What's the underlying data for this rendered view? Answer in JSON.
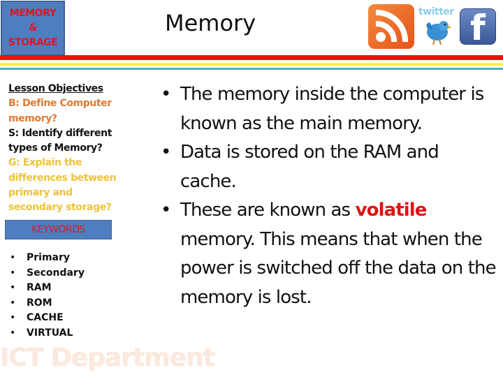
{
  "header": {
    "title_box_lines": [
      "MEMORY",
      "&",
      "STORAGE"
    ],
    "page_title": "Memory",
    "icons": {
      "rss": "rss-feed-icon",
      "twitter_word": "twitter",
      "facebook_letter": "f"
    },
    "stripe_colors": [
      "#ee1010",
      "#f9f542",
      "#4fb0bc"
    ]
  },
  "sidebar": {
    "objectives": {
      "heading": "Lesson Objectives",
      "b": "B: Define Computer memory?",
      "s": "S: Identify different types of Memory?",
      "g": "G: Explain the differences between primary and secondary storage?"
    },
    "keywords_label": "KEYWORDS",
    "keywords": [
      "Primary",
      "Secondary",
      "RAM",
      "ROM",
      "CACHE",
      "VIRTUAL"
    ],
    "department": "ICT Department"
  },
  "main": {
    "bullets": [
      {
        "text": "The memory inside the computer is known as the main memory."
      },
      {
        "text": "Data is stored on the RAM and cache."
      },
      {
        "before": "These are known as ",
        "highlight": "volatile",
        "after": " memory. This means that when the power is switched off the data on the memory is lost."
      }
    ]
  },
  "colors": {
    "title_box_bg": "#4f7ec0",
    "title_text": "#e0141e",
    "objective_b": "#dd7a33",
    "objective_g": "#edc33a",
    "highlight": "#dd1414"
  }
}
